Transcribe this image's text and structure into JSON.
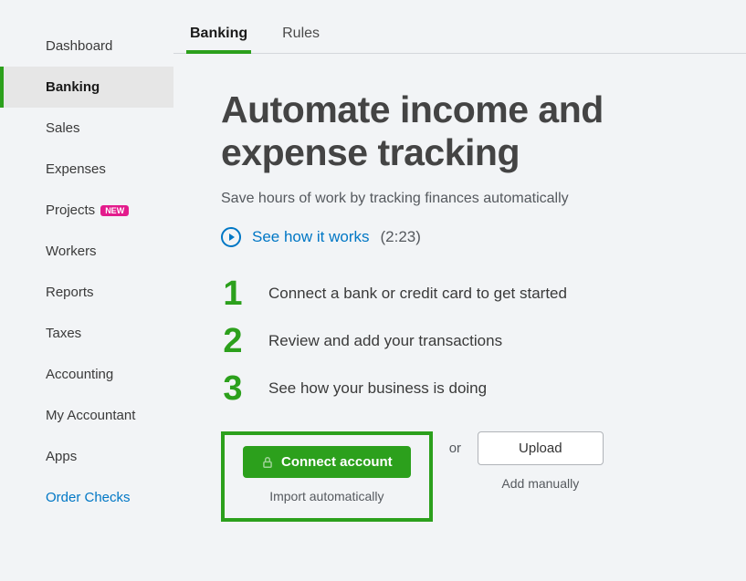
{
  "sidebar": {
    "items": [
      {
        "label": "Dashboard"
      },
      {
        "label": "Banking",
        "active": true
      },
      {
        "label": "Sales"
      },
      {
        "label": "Expenses"
      },
      {
        "label": "Projects",
        "badge": "NEW"
      },
      {
        "label": "Workers"
      },
      {
        "label": "Reports"
      },
      {
        "label": "Taxes"
      },
      {
        "label": "Accounting"
      },
      {
        "label": "My Accountant"
      },
      {
        "label": "Apps"
      },
      {
        "label": "Order Checks",
        "link": true
      }
    ]
  },
  "tabs": [
    {
      "label": "Banking",
      "active": true
    },
    {
      "label": "Rules"
    }
  ],
  "content": {
    "headline": "Automate income and expense tracking",
    "subhead": "Save hours of work by tracking finances automatically",
    "video_link": "See how it works",
    "video_time": "(2:23)",
    "steps": [
      "Connect a bank or credit card to get started",
      "Review and add your transactions",
      "See how your business is doing"
    ],
    "connect_btn": "Connect account",
    "connect_sub": "Import automatically",
    "or": "or",
    "upload_btn": "Upload",
    "upload_sub": "Add manually"
  }
}
